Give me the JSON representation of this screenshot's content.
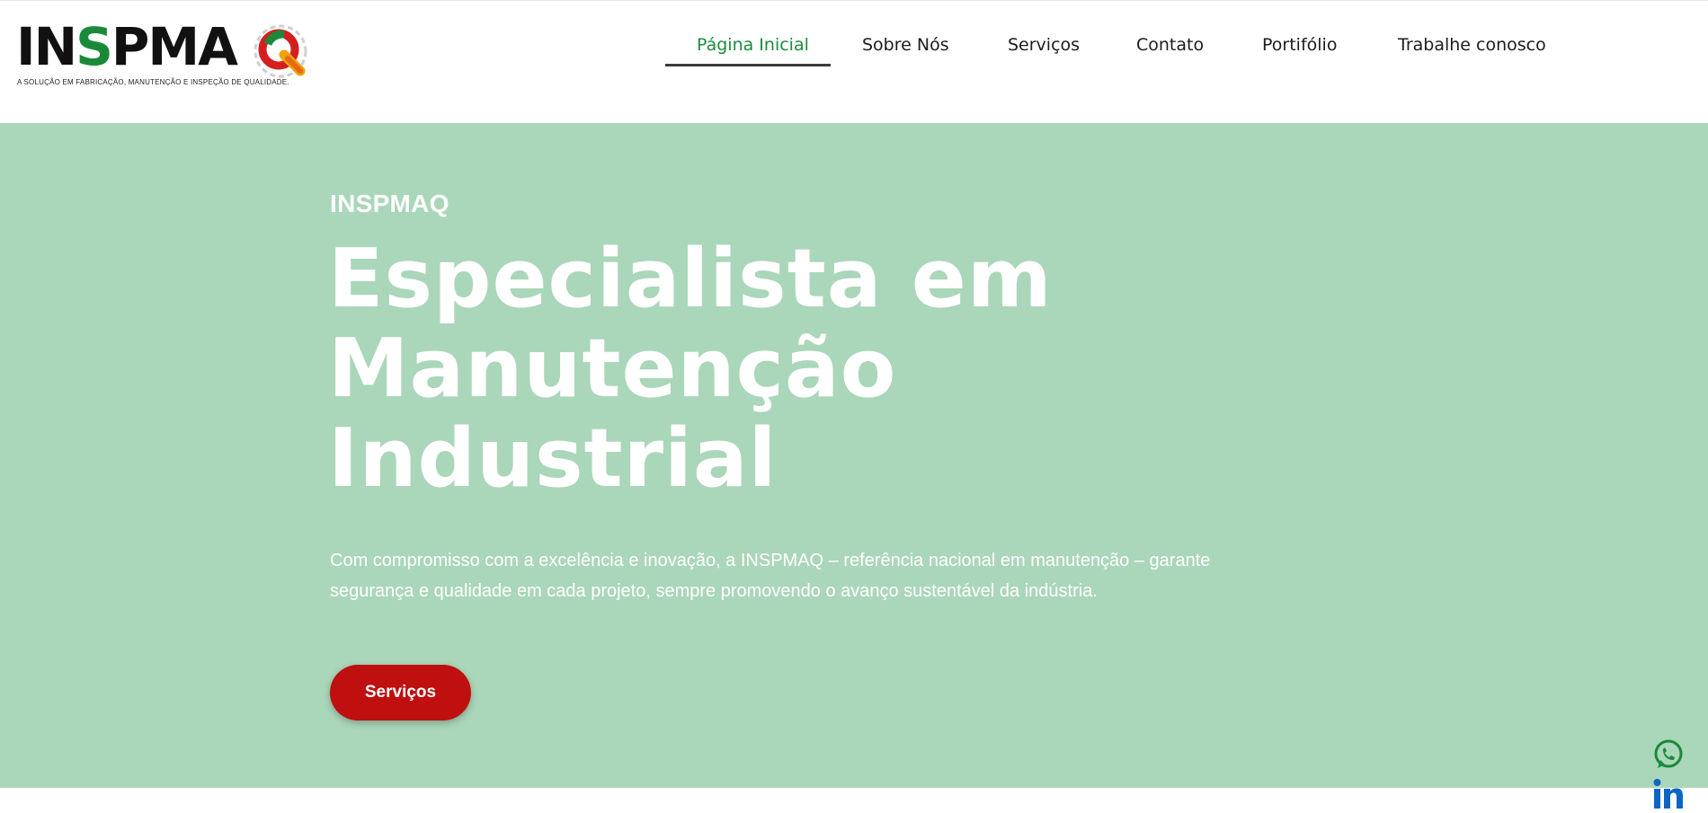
{
  "brand": {
    "logo_letters": [
      "IN",
      "S",
      "PMA",
      "Q"
    ],
    "tagline": "A solução em fabricação, manutenção e inspeção de qualidade."
  },
  "nav": {
    "items": [
      {
        "label": "Página Inicial",
        "active": true
      },
      {
        "label": "Sobre Nós",
        "active": false
      },
      {
        "label": "Serviços",
        "active": false
      },
      {
        "label": "Contato",
        "active": false
      },
      {
        "label": "Portifólio",
        "active": false
      },
      {
        "label": "Trabalhe conosco",
        "active": false
      }
    ]
  },
  "hero": {
    "eyebrow": "INSPMAQ",
    "headline_lines": [
      "Especialista em",
      "Manutenção",
      "Industrial"
    ],
    "lead": "Com compromisso com a excelência e inovação, a INSPMAQ – referência nacional em manutenção – garante segurança e qualidade em cada projeto, sempre promovendo o avanço sustentável da indústria.",
    "cta_label": "Serviços"
  },
  "social": {
    "whatsapp_icon": "whatsapp-icon",
    "linkedin_icon": "linkedin-icon"
  },
  "colors": {
    "accent_green": "#1b8c3a",
    "hero_bg": "#aad6b9",
    "cta_red": "#bf0f0f",
    "linkedin_blue": "#0a66c2",
    "whatsapp_green": "#1a8a3a"
  }
}
